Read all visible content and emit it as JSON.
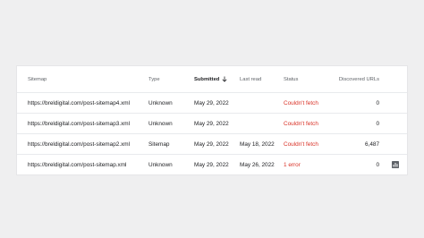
{
  "table": {
    "headers": {
      "sitemap": "Sitemap",
      "type": "Type",
      "submitted": "Submitted",
      "last_read": "Last read",
      "status": "Status",
      "discovered_urls": "Discovered URLs"
    },
    "sort_column": "submitted",
    "rows": [
      {
        "sitemap": "https://breldigital.com/post-sitemap4.xml",
        "type": "Unknown",
        "submitted": "May 29, 2022",
        "last_read": "",
        "status": "Couldn't fetch",
        "discovered_urls": "0"
      },
      {
        "sitemap": "https://breldigital.com/post-sitemap3.xml",
        "type": "Unknown",
        "submitted": "May 29, 2022",
        "last_read": "",
        "status": "Couldn't fetch",
        "discovered_urls": "0"
      },
      {
        "sitemap": "https://breldigital.com/post-sitemap2.xml",
        "type": "Sitemap",
        "submitted": "May 29, 2022",
        "last_read": "May 18, 2022",
        "status": "Couldn't fetch",
        "discovered_urls": "6,487"
      },
      {
        "sitemap": "https://breldigital.com/post-sitemap.xml",
        "type": "Unknown",
        "submitted": "May 29, 2022",
        "last_read": "May 26, 2022",
        "status": "1 error",
        "discovered_urls": "0"
      }
    ]
  },
  "colors": {
    "background": "#efeff0",
    "error": "#d93025",
    "icon": "#5f6368"
  },
  "icons": {
    "sort": "arrow-down-icon",
    "report": "bar-chart-icon"
  }
}
